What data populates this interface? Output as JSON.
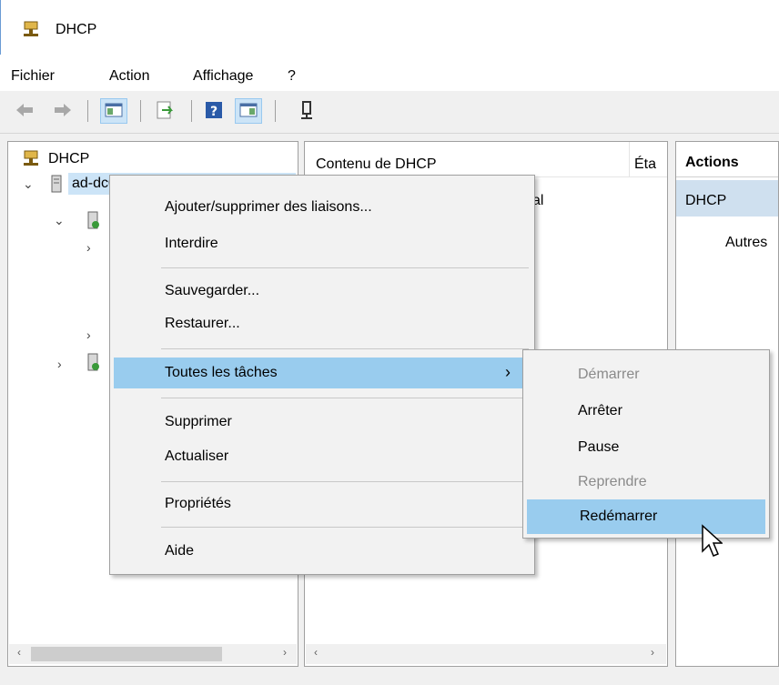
{
  "window": {
    "title": "DHCP"
  },
  "menubar": {
    "items": [
      "Fichier",
      "Action",
      "Affichage",
      "?"
    ]
  },
  "toolbar": {
    "icons": [
      "back-arrow-icon",
      "forward-arrow-icon",
      "show-hide-console-tree-icon",
      "export-list-icon",
      "help-icon",
      "show-hide-action-pane-icon",
      "server-status-icon"
    ]
  },
  "tree": {
    "root_label": "DHCP",
    "server_label": "ad-dc01"
  },
  "content": {
    "header_name": "Contenu de DHCP",
    "header_state": "Éta",
    "row_partial": "al"
  },
  "actions": {
    "header": "Actions",
    "section": "DHCP",
    "item": "Autres"
  },
  "context_menu": {
    "items": [
      {
        "label": "Ajouter/supprimer des liaisons...",
        "enabled": true
      },
      {
        "label": "Interdire",
        "enabled": true
      },
      {
        "label": "Sauvegarder...",
        "enabled": true
      },
      {
        "label": "Restaurer...",
        "enabled": true
      },
      {
        "label": "Toutes les tâches",
        "enabled": true,
        "submenu": true,
        "highlighted": true
      },
      {
        "label": "Supprimer",
        "enabled": true
      },
      {
        "label": "Actualiser",
        "enabled": true
      },
      {
        "label": "Propriétés",
        "enabled": true
      },
      {
        "label": "Aide",
        "enabled": true
      }
    ],
    "submenu_arrow": "›"
  },
  "submenu": {
    "items": [
      {
        "label": "Démarrer",
        "enabled": false
      },
      {
        "label": "Arrêter",
        "enabled": true
      },
      {
        "label": "Pause",
        "enabled": true
      },
      {
        "label": "Reprendre",
        "enabled": false
      },
      {
        "label": "Redémarrer",
        "enabled": true,
        "highlighted": true
      }
    ]
  },
  "statusbar": {
    "text": ""
  },
  "colors": {
    "highlight": "#99ccee",
    "selection": "#cce4f7",
    "border": "#a0a0a0"
  }
}
